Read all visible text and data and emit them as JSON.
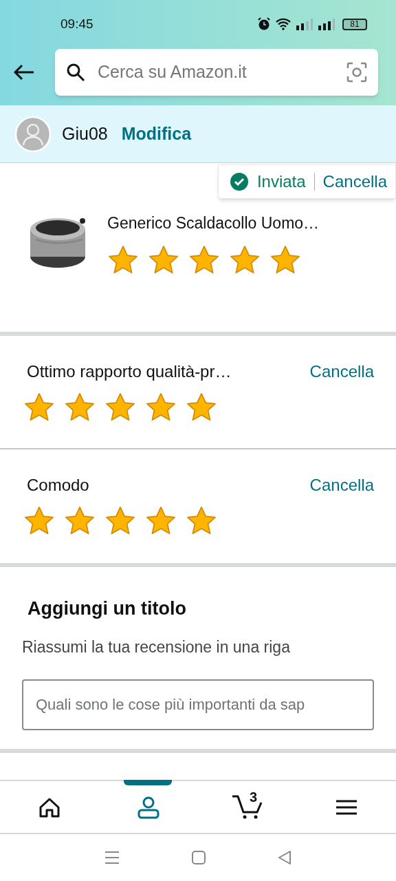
{
  "status_bar": {
    "time": "09:45",
    "battery": "81"
  },
  "search": {
    "placeholder": "Cerca su Amazon.it"
  },
  "profile": {
    "name": "Giu08",
    "edit_link": "Modifica"
  },
  "submission": {
    "status": "Inviata",
    "cancel": "Cancella"
  },
  "product": {
    "title": "Generico Scaldacollo Uomo…",
    "stars": 5
  },
  "ratings": [
    {
      "label": "Ottimo rapporto qualità-pr…",
      "cancel": "Cancella",
      "stars": 5
    },
    {
      "label": "Comodo",
      "cancel": "Cancella",
      "stars": 5
    }
  ],
  "title_section": {
    "heading": "Aggiungi un titolo",
    "hint": "Riassumi la tua recensione in una riga",
    "placeholder": "Quali sono le cose più importanti da sap"
  },
  "bottom_nav": [
    {
      "kind": "home",
      "selected": false
    },
    {
      "kind": "account",
      "selected": true
    },
    {
      "kind": "cart",
      "badge": "3",
      "selected": false
    },
    {
      "kind": "menu",
      "selected": false
    }
  ]
}
